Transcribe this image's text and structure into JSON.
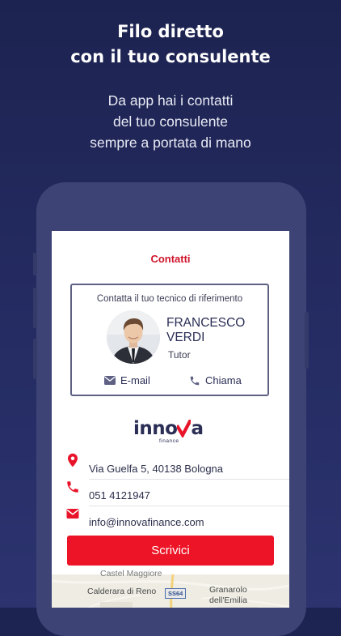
{
  "promo": {
    "title_lines": [
      "Filo diretto",
      "con il tuo consulente"
    ],
    "subtitle_lines": [
      "Da app hai i contatti",
      "del tuo consulente",
      "sempre a portata di mano"
    ]
  },
  "screen": {
    "header_title": "Contatti",
    "card": {
      "caption": "Contatta il tuo tecnico di riferimento",
      "name_lines": [
        "FRANCESCO",
        "VERDI"
      ],
      "role": "Tutor",
      "email_label": "E-mail",
      "call_label": "Chiama"
    },
    "logo": {
      "word_start": "inno",
      "word_end": "a",
      "sub": "finance"
    },
    "contacts": {
      "address": "Via Guelfa 5, 40138 Bologna",
      "phone": "051 4121947",
      "email": "info@innovafinance.com"
    },
    "write_button": "Scrivici",
    "map": {
      "top_label": "Castel Maggiore",
      "label_calderara": "Calderara di Reno",
      "label_granarolo": "Granarolo",
      "label_emilia": "dell'Emilia",
      "road": "SS64"
    }
  },
  "colors": {
    "accent_red": "#ec1426",
    "header_red": "#d0142c",
    "navy": "#2a2e55",
    "background": "#1d2350"
  }
}
